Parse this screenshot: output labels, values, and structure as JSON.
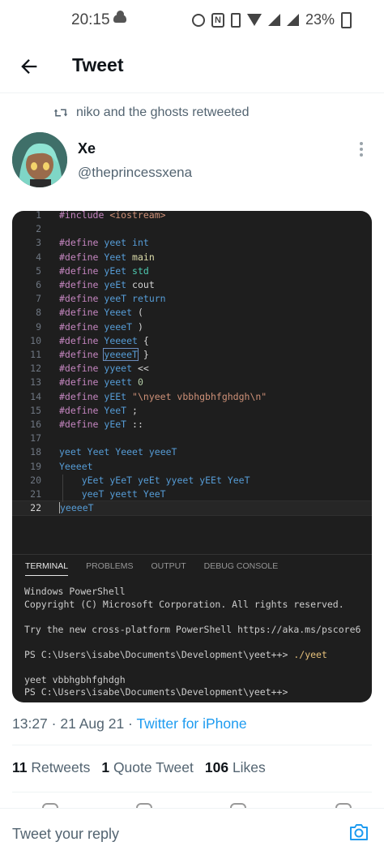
{
  "status_bar": {
    "time": "20:15",
    "battery": "23%"
  },
  "header": {
    "title": "Tweet"
  },
  "social_context": "niko and the ghosts retweeted",
  "author": {
    "name": "Xe",
    "handle": "@theprincessxena"
  },
  "code_lines": [
    {
      "n": "1",
      "text": "#include <iostream>"
    },
    {
      "n": "2",
      "text": ""
    },
    {
      "n": "3",
      "text": "#define yeet int"
    },
    {
      "n": "4",
      "text": "#define Yeet main"
    },
    {
      "n": "5",
      "text": "#define yEet std"
    },
    {
      "n": "6",
      "text": "#define yeEt cout"
    },
    {
      "n": "7",
      "text": "#define yeeT return"
    },
    {
      "n": "8",
      "text": "#define Yeeet ("
    },
    {
      "n": "9",
      "text": "#define yeeeT )"
    },
    {
      "n": "10",
      "text": "#define Yeeeet {"
    },
    {
      "n": "11",
      "text": "#define yeeeeT }"
    },
    {
      "n": "12",
      "text": "#define yyeet <<"
    },
    {
      "n": "13",
      "text": "#define yeett 0"
    },
    {
      "n": "14",
      "text": "#define yEEt \"\\nyeet vbbhgbhfghdgh\\n\""
    },
    {
      "n": "15",
      "text": "#define YeeT ;"
    },
    {
      "n": "16",
      "text": "#define yEeT ::"
    },
    {
      "n": "17",
      "text": ""
    },
    {
      "n": "18",
      "text": "yeet Yeet Yeeet yeeeT"
    },
    {
      "n": "19",
      "text": "Yeeeet"
    },
    {
      "n": "20",
      "text": "    yEet yEeT yeEt yyeet yEEt YeeT"
    },
    {
      "n": "21",
      "text": "    yeeT yeett YeeT"
    },
    {
      "n": "22",
      "text": "yeeeeT"
    }
  ],
  "panel_tabs": [
    "TERMINAL",
    "PROBLEMS",
    "OUTPUT",
    "DEBUG CONSOLE"
  ],
  "terminal": {
    "line1": "Windows PowerShell",
    "line2": "Copyright (C) Microsoft Corporation. All rights reserved.",
    "line3": "Try the new cross-platform PowerShell https://aka.ms/pscore6",
    "prompt1": "PS C:\\Users\\isabe\\Documents\\Development\\yeet++> ",
    "cmd1": "./yeet",
    "output1": "yeet vbbhgbhfghdgh",
    "prompt2": "PS C:\\Users\\isabe\\Documents\\Development\\yeet++>"
  },
  "tweet_meta": {
    "time": "13:27",
    "date": "21 Aug 21",
    "source": "Twitter for iPhone"
  },
  "stats": {
    "retweets_count": "11",
    "retweets_label": "Retweets",
    "quotes_count": "1",
    "quotes_label": "Quote Tweet",
    "likes_count": "106",
    "likes_label": "Likes"
  },
  "reply": {
    "placeholder": "Tweet your reply"
  },
  "colors": {
    "accent": "#1d9bf0",
    "editor_bg": "#1e1e1e"
  }
}
